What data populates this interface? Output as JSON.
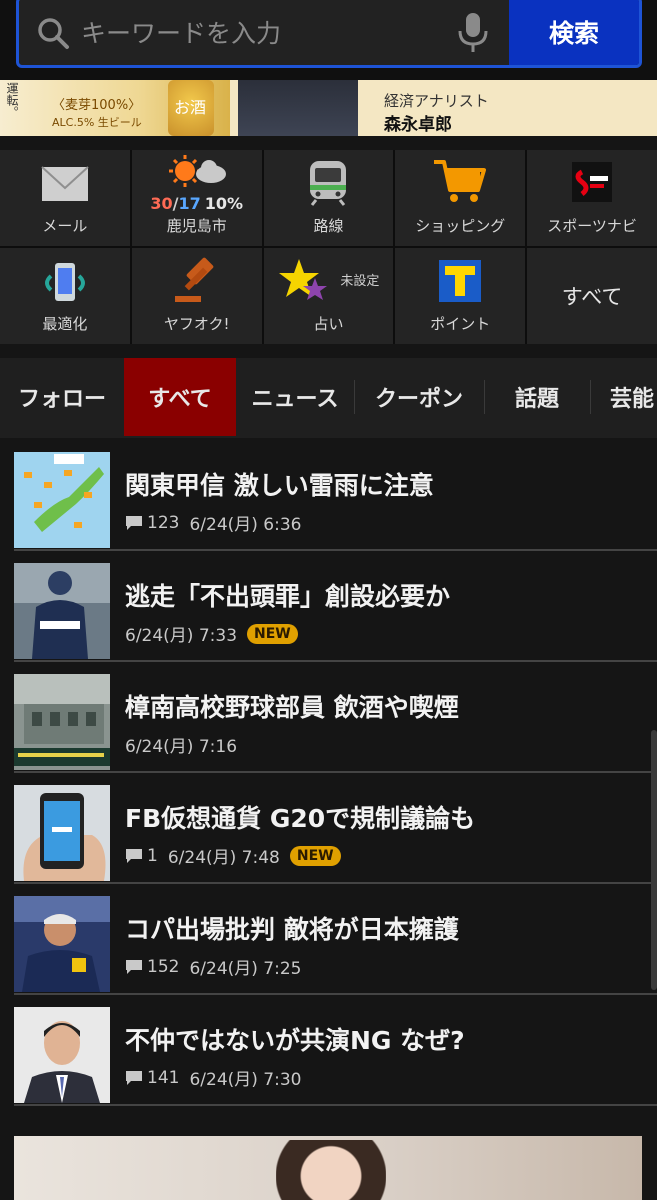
{
  "search": {
    "placeholder": "キーワードを入力",
    "button_label": "検索"
  },
  "banner": {
    "vertical_text": "運転。",
    "line1": "〈麦芽100%〉",
    "line2": "ALC.5% 生ビール",
    "can_text": "お酒",
    "subtitle": "経済アナリスト",
    "name": "森永卓郎"
  },
  "services": [
    {
      "label": "メール",
      "icon": "mail-icon"
    },
    {
      "label": "鹿児島市",
      "icon": "weather-icon",
      "temp_high": "30",
      "temp_sep": "/",
      "temp_low": "17",
      "rain": "10%"
    },
    {
      "label": "路線",
      "icon": "train-icon"
    },
    {
      "label": "ショッピング",
      "icon": "shopping-cart-icon"
    },
    {
      "label": "スポーツナビ",
      "icon": "sportsnavi-icon"
    },
    {
      "label": "最適化",
      "icon": "phone-optimize-icon"
    },
    {
      "label": "ヤフオク!",
      "icon": "auction-hammer-icon"
    },
    {
      "label": "占い",
      "icon": "fortune-star-icon",
      "tag": "未設定"
    },
    {
      "label": "ポイント",
      "icon": "tpoint-icon"
    },
    {
      "label": "すべて",
      "icon": ""
    }
  ],
  "tabs": [
    {
      "label": "フォロー",
      "active": false
    },
    {
      "label": "すべて",
      "active": true
    },
    {
      "label": "ニュース",
      "active": false
    },
    {
      "label": "クーポン",
      "active": false
    },
    {
      "label": "話題",
      "active": false
    },
    {
      "label": "芸能",
      "active": false
    }
  ],
  "news": [
    {
      "title": "関東甲信 激しい雷雨に注意",
      "comments": "123",
      "time": "6/24(月) 6:36",
      "new": false,
      "thumb": "weather-map"
    },
    {
      "title": "逃走「不出頭罪」創設必要か",
      "comments": "",
      "time": "6/24(月) 7:33",
      "new": true,
      "thumb": "police"
    },
    {
      "title": "樟南高校野球部員 飲酒や喫煙",
      "comments": "",
      "time": "6/24(月) 7:16",
      "new": false,
      "thumb": "school"
    },
    {
      "title": "FB仮想通貨 G20で規制議論も",
      "comments": "1",
      "time": "6/24(月) 7:48",
      "new": true,
      "thumb": "facebook-phone"
    },
    {
      "title": "コパ出場批判 敵将が日本擁護",
      "comments": "152",
      "time": "6/24(月) 7:25",
      "new": false,
      "thumb": "coach"
    },
    {
      "title": "不仲ではないが共演NG なぜ?",
      "comments": "141",
      "time": "6/24(月) 7:30",
      "new": false,
      "thumb": "man-suit"
    }
  ],
  "new_badge": "NEW",
  "colors": {
    "accent_blue": "#0a32c0",
    "active_tab": "#8a0000",
    "temp_high": "#ff6b55",
    "temp_low": "#59a7ff",
    "new_badge": "#e0a000"
  }
}
